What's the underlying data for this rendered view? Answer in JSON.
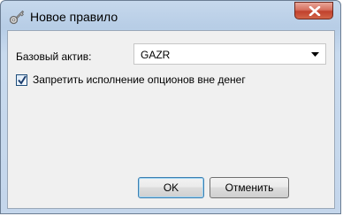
{
  "window": {
    "title": "Новое правило",
    "icon": "key-icon"
  },
  "form": {
    "asset_label": "Базовый актив:",
    "asset_value": "GAZR",
    "checkbox_label": "Запретить исполнение опционов вне денег",
    "checkbox_checked": true
  },
  "buttons": {
    "ok": "OK",
    "cancel": "Отменить"
  }
}
